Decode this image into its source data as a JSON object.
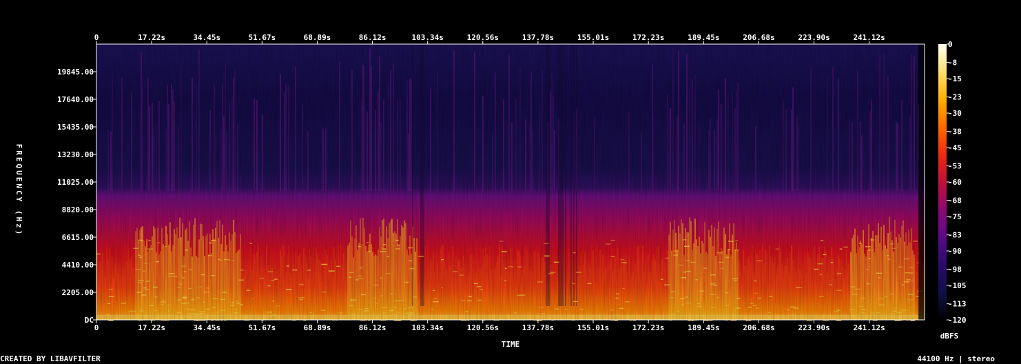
{
  "chart_data": {
    "type": "heatmap",
    "xlabel": "TIME",
    "ylabel": "FREQUENCY (Hz)",
    "x_ticks": [
      "0",
      "17.22s",
      "34.45s",
      "51.67s",
      "68.89s",
      "86.12s",
      "103.34s",
      "120.56s",
      "137.78s",
      "155.01s",
      "172.23s",
      "189.45s",
      "206.68s",
      "223.90s",
      "241.12s"
    ],
    "y_ticks": [
      "DC",
      "2205.00",
      "4410.00",
      "6615.00",
      "8820.00",
      "11025.00",
      "13230.00",
      "15435.00",
      "17640.00",
      "19845.00"
    ],
    "y_tick_values": [
      0,
      2205,
      4410,
      6615,
      8820,
      11025,
      13230,
      15435,
      17640,
      19845
    ],
    "x_range_seconds": [
      0,
      258.4
    ],
    "y_range_hz": [
      0,
      22050
    ],
    "colorbar": {
      "label": "dBFS",
      "ticks": [
        "0",
        "-8",
        "-15",
        "-23",
        "-30",
        "-38",
        "-45",
        "-53",
        "-60",
        "-68",
        "-75",
        "-83",
        "-90",
        "-98",
        "-105",
        "-113",
        "-120"
      ],
      "range": [
        -120,
        0
      ],
      "colors": [
        "#000000",
        "#10104a",
        "#2a0a6a",
        "#5a0a8a",
        "#8a0a70",
        "#c0103a",
        "#ee2a10",
        "#ff6a00",
        "#ffb000",
        "#ffe070",
        "#fffff0"
      ]
    },
    "energy_profile": {
      "cutoff_hz": 10300,
      "quiet_region_seconds": [
        [
          98,
          102
        ],
        [
          140,
          150
        ]
      ],
      "loud_region_seconds": [
        [
          12,
          45
        ],
        [
          78,
          100
        ],
        [
          178,
          200
        ],
        [
          235,
          255
        ]
      ]
    }
  },
  "footer": {
    "left": "CREATED BY LIBAVFILTER",
    "right": "44100 Hz | stereo"
  }
}
